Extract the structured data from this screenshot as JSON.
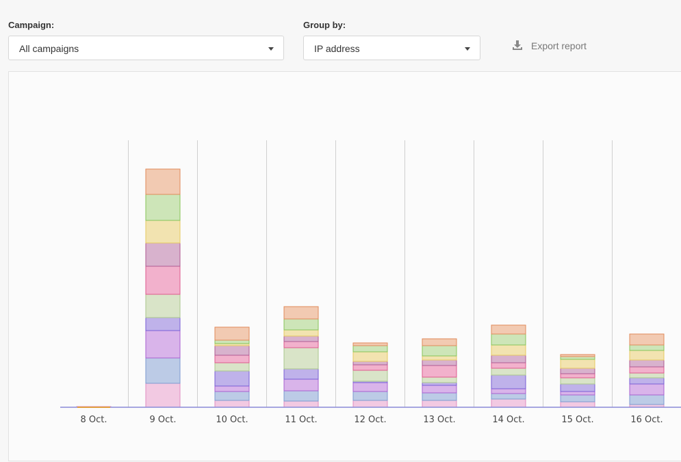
{
  "filters": {
    "campaign": {
      "label": "Campaign:",
      "value": "All campaigns"
    },
    "group_by": {
      "label": "Group by:",
      "value": "IP address"
    }
  },
  "export": {
    "label": "Export report",
    "icon": "download-icon"
  },
  "chart_data": {
    "type": "bar",
    "stacked": true,
    "categories": [
      "8 Oct.",
      "9 Oct.",
      "10 Oct.",
      "11 Oct.",
      "12 Oct.",
      "13 Oct.",
      "14 Oct.",
      "15 Oct.",
      "16 Oct."
    ],
    "ylim": [
      0,
      390
    ],
    "grid": "vertical",
    "segment_palette": [
      {
        "fill": "#f2c9e2",
        "stroke": "#e08cc0"
      },
      {
        "fill": "#bccbe6",
        "stroke": "#7d9ad0"
      },
      {
        "fill": "#d9b4ea",
        "stroke": "#a860d0"
      },
      {
        "fill": "#bfb2ea",
        "stroke": "#7a5ed6"
      },
      {
        "fill": "#d9e4c8",
        "stroke": "#a9c68c"
      },
      {
        "fill": "#f2b1cc",
        "stroke": "#de5a8e"
      },
      {
        "fill": "#d8b2cd",
        "stroke": "#b05b92"
      },
      {
        "fill": "#f2e3b0",
        "stroke": "#e5c860"
      },
      {
        "fill": "#cde5b8",
        "stroke": "#88c458"
      },
      {
        "fill": "#f2cab2",
        "stroke": "#e08a5a"
      }
    ],
    "stacks": [
      [
        1
      ],
      [
        35,
        37,
        40,
        19,
        34,
        41,
        34,
        33,
        38,
        37
      ],
      [
        10,
        13,
        8,
        22,
        12,
        11,
        14,
        3,
        5,
        19
      ],
      [
        9,
        15,
        17,
        15,
        31,
        9,
        8,
        9,
        16,
        18
      ],
      [
        10,
        13,
        13,
        2,
        16,
        8,
        5,
        14,
        9,
        4
      ],
      [
        10,
        11,
        11,
        4,
        8,
        17,
        8,
        6,
        15,
        10
      ],
      [
        12,
        8,
        7,
        20,
        10,
        8,
        11,
        15,
        16,
        13
      ],
      [
        8,
        10,
        5,
        11,
        9,
        6,
        8,
        13,
        4,
        3
      ],
      [
        4,
        14,
        16,
        9,
        7,
        9,
        10,
        14,
        8,
        16
      ]
    ]
  }
}
